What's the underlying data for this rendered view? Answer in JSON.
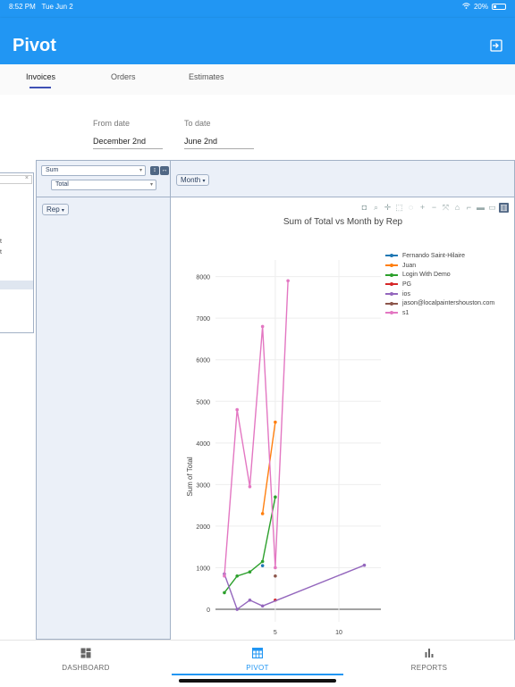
{
  "status": {
    "time": "8:52 PM",
    "date": "Tue Jun 2",
    "battery": "20%"
  },
  "app": {
    "title": "Pivot"
  },
  "tabs": [
    {
      "label": "Invoices",
      "active": true
    },
    {
      "label": "Orders",
      "active": false
    },
    {
      "label": "Estimates",
      "active": false
    }
  ],
  "filters": {
    "from_label": "From date",
    "from_value": "December 2nd",
    "to_label": "To date",
    "to_value": "June 2nd"
  },
  "left_panel": {
    "close": "×",
    "fragments": [
      "t",
      "t"
    ]
  },
  "pivot": {
    "aggregator": "Sum",
    "value_field": "Total",
    "col_field": "Month",
    "row_field": "Rep",
    "sort_icons": [
      "↕",
      "↔"
    ]
  },
  "chart_data": {
    "type": "line",
    "title": "Sum of Total vs Month by Rep",
    "ylabel": "Sum of Total",
    "xlabel": "",
    "xlim": [
      0.3,
      13.3
    ],
    "ylim": [
      -300,
      8400
    ],
    "xticks": [
      5,
      10
    ],
    "yticks": [
      0,
      1000,
      2000,
      3000,
      4000,
      5000,
      6000,
      7000,
      8000
    ],
    "grid": true,
    "legend_position": "top-right",
    "series": [
      {
        "name": "Fernando Saint-Hilaire",
        "color": "#1f77b4",
        "x": [
          4
        ],
        "y": [
          1050
        ]
      },
      {
        "name": "Juan",
        "color": "#ff7f0e",
        "x": [
          4,
          5
        ],
        "y": [
          2300,
          4500
        ]
      },
      {
        "name": "Login With Demo",
        "color": "#2ca02c",
        "x": [
          1,
          2,
          3,
          4,
          5
        ],
        "y": [
          400,
          800,
          900,
          1150,
          2700
        ]
      },
      {
        "name": "PG",
        "color": "#d62728",
        "x": [
          5
        ],
        "y": [
          220
        ]
      },
      {
        "name": "ios",
        "color": "#9467bd",
        "x": [
          1,
          2,
          3,
          4,
          12
        ],
        "y": [
          850,
          0,
          220,
          80,
          1060
        ]
      },
      {
        "name": "jason@localpaintershouston.com",
        "color": "#8c564b",
        "x": [
          5
        ],
        "y": [
          800
        ]
      },
      {
        "name": "s1",
        "color": "#e377c2",
        "x": [
          1,
          2,
          3,
          4,
          5,
          6
        ],
        "y": [
          800,
          4800,
          2950,
          6800,
          1000,
          7900
        ]
      }
    ]
  },
  "bottom_nav": [
    {
      "label": "DASHBOARD",
      "icon": "dashboard-icon",
      "active": false
    },
    {
      "label": "PIVOT",
      "icon": "table-icon",
      "active": true
    },
    {
      "label": "REPORTS",
      "icon": "bar-chart-icon",
      "active": false
    }
  ]
}
